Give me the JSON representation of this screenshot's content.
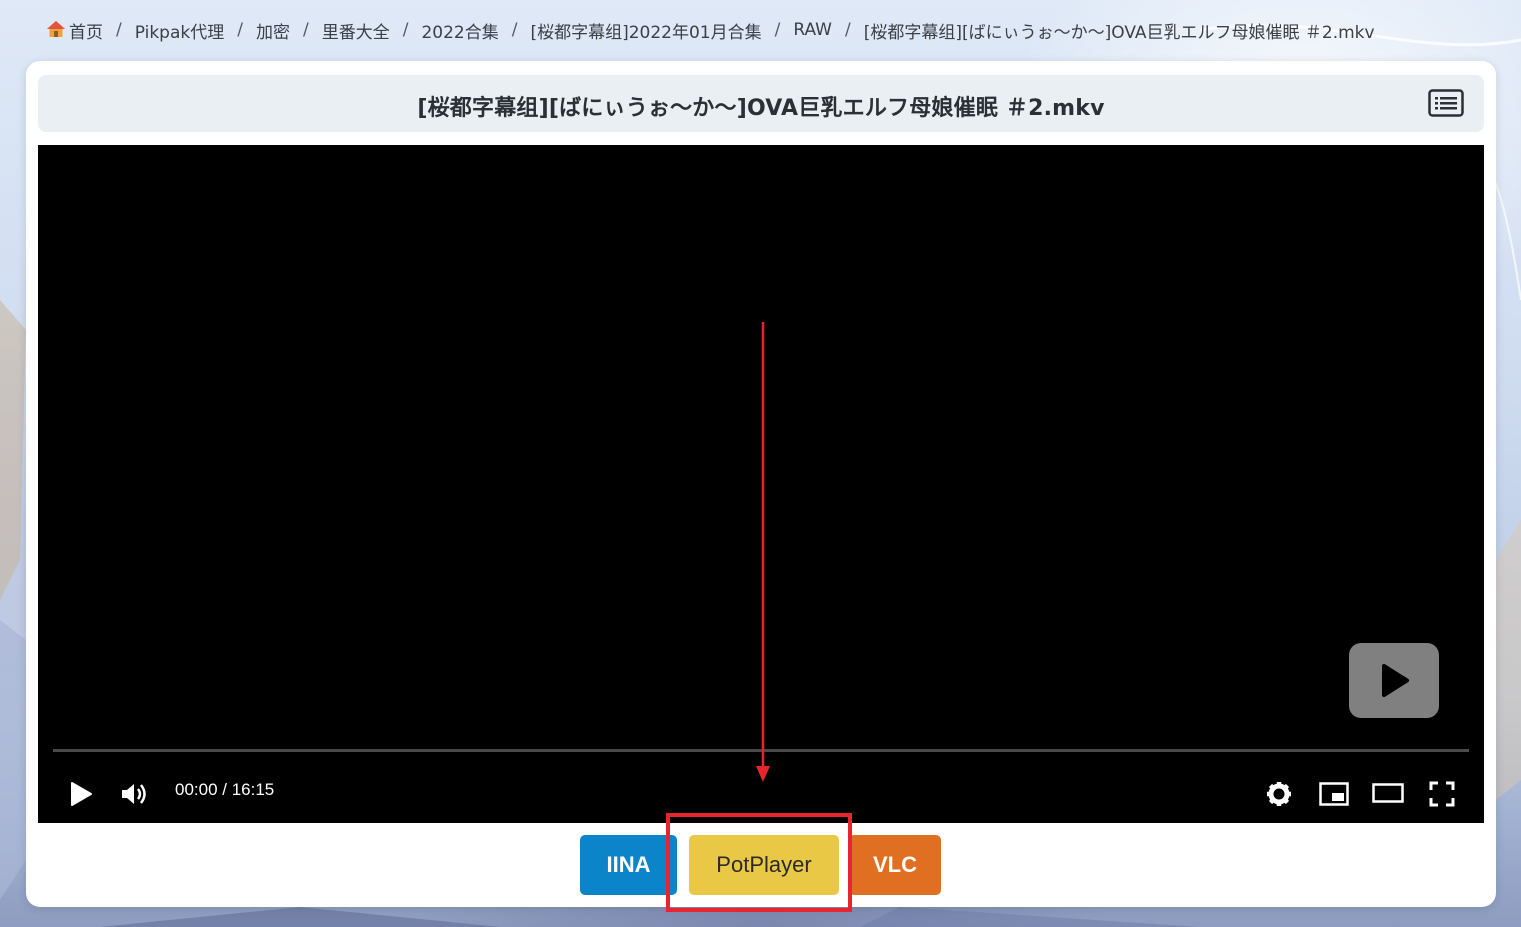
{
  "breadcrumb": {
    "items": [
      "首页",
      "Pikpak代理",
      "加密",
      "里番大全",
      "2022合集",
      "[桜都字幕组]2022年01月合集",
      "RAW",
      "[桜都字幕组][ばにぃうぉ～か～]OVA巨乳エルフ母娘催眠 ＃2.mkv"
    ],
    "separator": "/"
  },
  "title_bar": {
    "title": "[桜都字幕组][ばにぃうぉ～か～]OVA巨乳エルフ母娘催眠 ＃2.mkv",
    "list_icon": "list-icon"
  },
  "player": {
    "current_time": "00:00",
    "duration": "16:15",
    "time_display": "00:00 / 16:15",
    "progress": 0,
    "icons": [
      "play-icon",
      "volume-icon",
      "settings-icon",
      "pip-icon",
      "theater-icon",
      "fullscreen-icon"
    ]
  },
  "external_players": {
    "buttons": [
      {
        "label": "IINA",
        "color": "#0c84c9"
      },
      {
        "label": "PotPlayer",
        "color": "#e9c846"
      },
      {
        "label": "VLC",
        "color": "#e06f21"
      }
    ]
  },
  "annotation": {
    "arrow_color": "#e8242f",
    "highlight_target": "PotPlayer"
  }
}
